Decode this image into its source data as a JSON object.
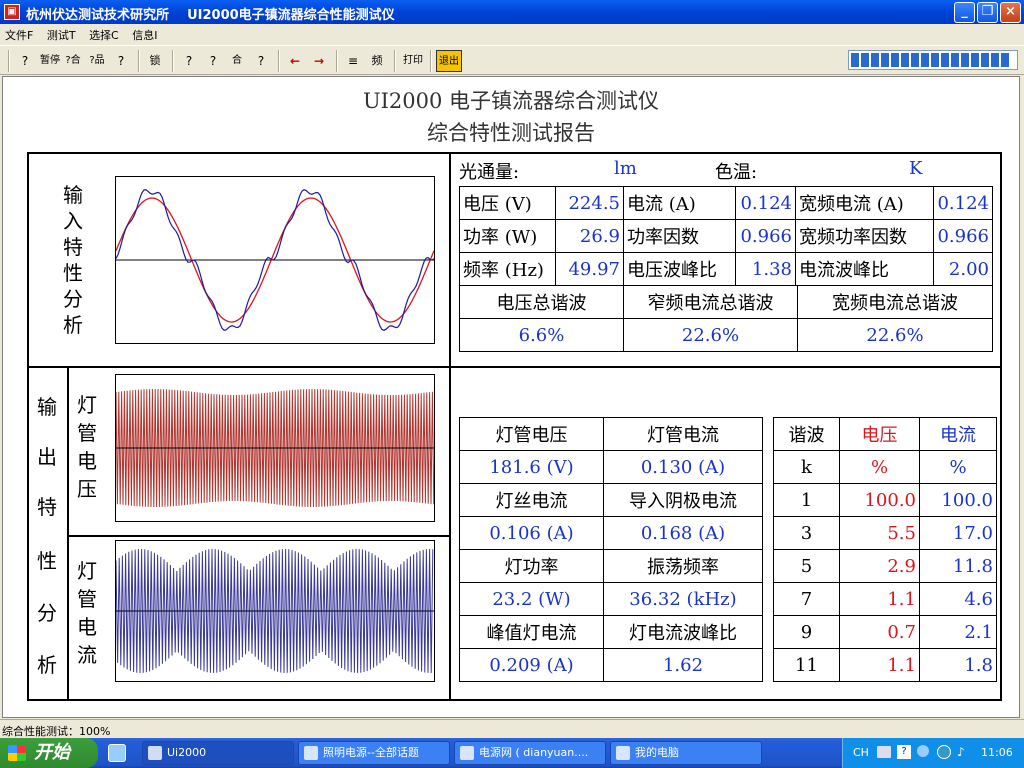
{
  "window": {
    "app_icon": "app-icon",
    "title": "杭州伏达测试技术研究所    UI2000电子镇流器综合性能测试仪"
  },
  "menu": [
    "文件F",
    "测试T",
    "选择C",
    "信息I"
  ],
  "toolbar": {
    "buttons": [
      "?",
      "暂停",
      "?合",
      "?品",
      "?",
      "锁",
      "?",
      "?",
      "合",
      "?",
      "←",
      "→",
      "≡",
      "频",
      "打印",
      "退出"
    ]
  },
  "report": {
    "title1": "UI2000 电子镇流器综合测试仪",
    "title2": "综合特性测试报告",
    "input_label": [
      "输",
      "入",
      "特",
      "性",
      "分",
      "析"
    ],
    "output_label": [
      "输",
      "出",
      "特",
      "性",
      "分",
      "析"
    ],
    "lamp_voltage_label": [
      "灯",
      "管",
      "电",
      "压"
    ],
    "lamp_current_label": [
      "灯",
      "管",
      "电",
      "流"
    ],
    "flux_label": "光通量:",
    "flux_unit": "lm",
    "colortemp_label": "色温:",
    "colortemp_unit": "K",
    "input_table": [
      [
        "电压 (V)",
        "224.5",
        "电流 (A)",
        "0.124",
        "宽频电流 (A)",
        "0.124"
      ],
      [
        "功率 (W)",
        "26.9",
        "功率因数",
        "0.966",
        "宽频功率因数",
        "0.966"
      ],
      [
        "频率 (Hz)",
        "49.97",
        "电压波峰比",
        "1.38",
        "电流波峰比",
        "2.00"
      ]
    ],
    "thd_headers": [
      "电压总谐波",
      "窄频电流总谐波",
      "宽频电流总谐波"
    ],
    "thd_values": [
      "6.6%",
      "22.6%",
      "22.6%"
    ],
    "output_table": [
      [
        "灯管电压",
        "灯管电流"
      ],
      [
        "181.6 (V)",
        "0.130 (A)"
      ],
      [
        "灯丝电流",
        "导入阴极电流"
      ],
      [
        "0.106 (A)",
        "0.168 (A)"
      ],
      [
        "灯功率",
        "振荡频率"
      ],
      [
        "23.2 (W)",
        "36.32 (kHz)"
      ],
      [
        "峰值灯电流",
        "灯电流波峰比"
      ],
      [
        "0.209 (A)",
        "1.62"
      ]
    ],
    "harmonic_headers": [
      "谐波",
      "电压",
      "电流"
    ],
    "harmonic_rows": [
      [
        "k",
        "%",
        "%"
      ],
      [
        "1",
        "100.0",
        "100.0"
      ],
      [
        "3",
        "5.5",
        "17.0"
      ],
      [
        "5",
        "2.9",
        "11.8"
      ],
      [
        "7",
        "1.1",
        "4.6"
      ],
      [
        "9",
        "0.7",
        "2.1"
      ],
      [
        "11",
        "1.1",
        "1.8"
      ]
    ]
  },
  "status": "综合性能测试：100%",
  "taskbar": {
    "start": "开始",
    "tasks": [
      "Ui2000",
      "照明电源--全部话题",
      "电源网 ( dianyuan....",
      "我的电脑"
    ],
    "tray_lang": "CH",
    "clock": "11:06"
  },
  "colors": {
    "voltage_curve": "#e0141c",
    "current_curve": "#1a1aa8",
    "lamp_voltage_wave": "#b0352f",
    "lamp_current_wave": "#3a3a9a",
    "value_blue": "#1a33cc",
    "value_red": "#e0141c"
  }
}
